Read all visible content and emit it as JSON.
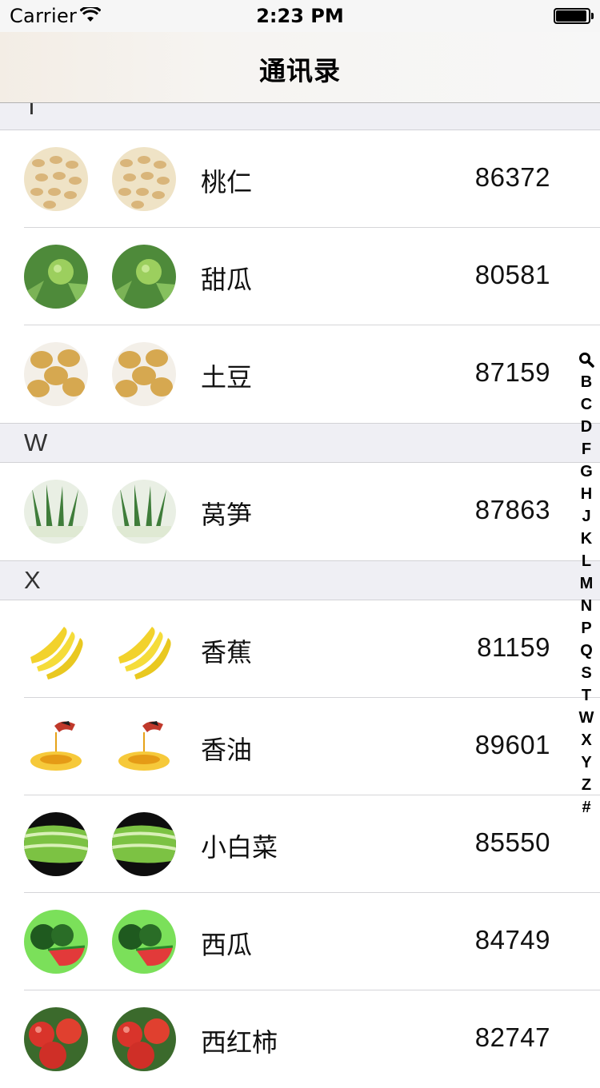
{
  "status_bar": {
    "carrier": "Carrier",
    "time": "2:23 PM"
  },
  "nav": {
    "title": "通讯录"
  },
  "sections": [
    {
      "letter": "T",
      "rows": [
        {
          "name": "桃仁",
          "phone": "86372",
          "icon": "walnut-kernels-icon"
        },
        {
          "name": "甜瓜",
          "phone": "80581",
          "icon": "melon-icon"
        },
        {
          "name": "土豆",
          "phone": "87159",
          "icon": "potato-icon"
        }
      ]
    },
    {
      "letter": "W",
      "rows": [
        {
          "name": "莴笋",
          "phone": "87863",
          "icon": "lettuce-stem-icon"
        }
      ]
    },
    {
      "letter": "X",
      "rows": [
        {
          "name": "香蕉",
          "phone": "81159",
          "icon": "banana-icon"
        },
        {
          "name": "香油",
          "phone": "89601",
          "icon": "sesame-oil-icon"
        },
        {
          "name": "小白菜",
          "phone": "85550",
          "icon": "bok-choy-icon"
        },
        {
          "name": "西瓜",
          "phone": "84749",
          "icon": "watermelon-icon"
        },
        {
          "name": "西红柿",
          "phone": "82747",
          "icon": "tomato-icon"
        }
      ]
    }
  ],
  "index_bar": [
    "B",
    "C",
    "D",
    "F",
    "G",
    "H",
    "J",
    "K",
    "L",
    "M",
    "N",
    "P",
    "Q",
    "S",
    "T",
    "W",
    "X",
    "Y",
    "Z",
    "#"
  ]
}
